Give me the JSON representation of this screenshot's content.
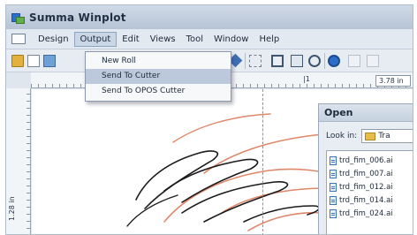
{
  "window": {
    "title": "Summa Winplot"
  },
  "menubar": {
    "items": [
      {
        "label": "Design"
      },
      {
        "label": "Output",
        "active": true
      },
      {
        "label": "Edit"
      },
      {
        "label": "Views"
      },
      {
        "label": "Tool"
      },
      {
        "label": "Window"
      },
      {
        "label": "Help"
      }
    ]
  },
  "output_menu": {
    "items": [
      {
        "label": "New Roll"
      },
      {
        "label": "Send To Cutter",
        "highlighted": true
      },
      {
        "label": "Send To OPOS Cutter"
      }
    ]
  },
  "toolbar": {
    "icons": [
      "open-folder-icon",
      "new-document-icon",
      "image-icon",
      "pen-icon",
      "select-rect-icon",
      "zoom-icon",
      "fit-icon",
      "weed-icon",
      "cut-icon",
      "disabled-icon",
      "disabled-icon"
    ]
  },
  "rulers": {
    "left_label": "1.28 in",
    "top_marker": "|1",
    "zoom_value": "3.78 in"
  },
  "open_dialog": {
    "title": "Open",
    "look_in_label": "Look in:",
    "look_in_value": "Tra",
    "files": [
      "trd_fim_006.ai",
      "trd_fim_007.ai",
      "trd_fim_012.ai",
      "trd_fim_014.ai",
      "trd_fim_024.ai"
    ]
  },
  "colors": {
    "accent": "#2b6ec9",
    "orange_stroke": "#e0876a",
    "black_stroke": "#1b1b1b"
  }
}
